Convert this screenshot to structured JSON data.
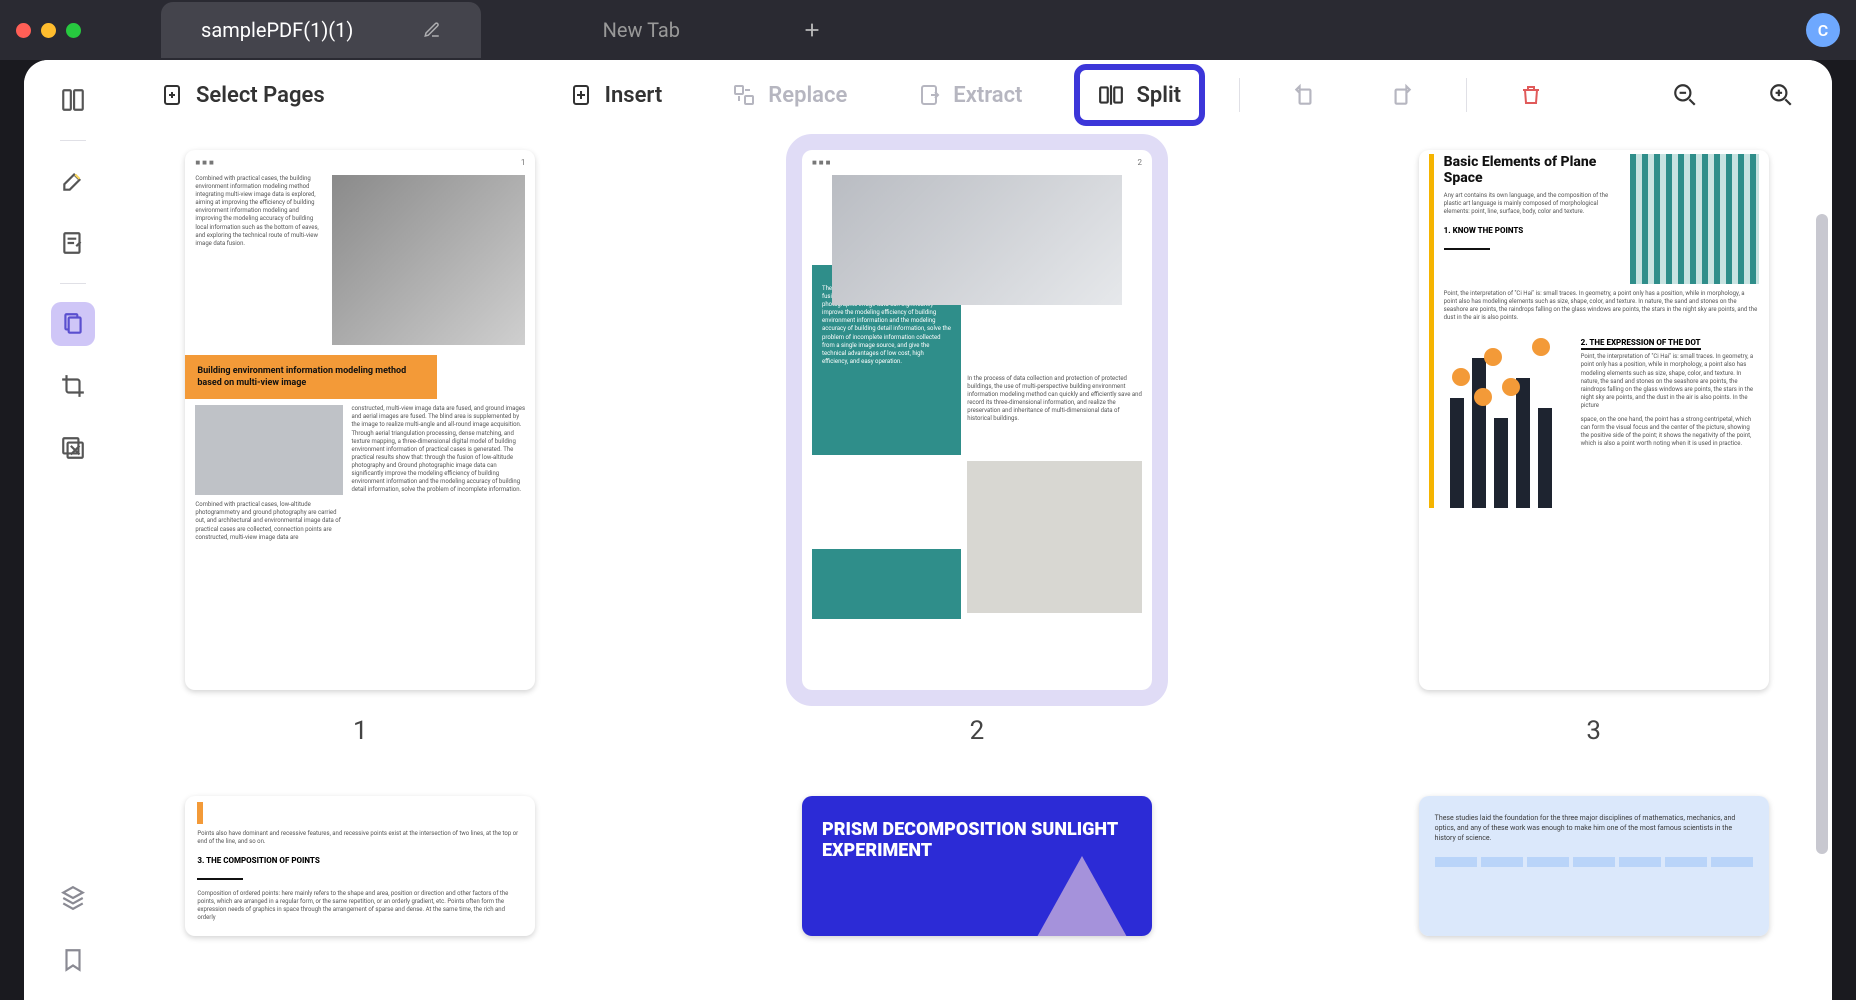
{
  "tabs": {
    "active_title": "samplePDF(1)(1)",
    "new_tab_label": "New Tab"
  },
  "avatar_initial": "C",
  "toolbar": {
    "select_pages": "Select Pages",
    "insert": "Insert",
    "replace": "Replace",
    "extract": "Extract",
    "split": "Split"
  },
  "pages": {
    "p1_num": "1",
    "p2_num": "2",
    "p3_num": "3",
    "p1_hdr_r": "1",
    "p2_hdr_r": "2",
    "p1_orange_title": "Building environment information modeling method based on multi-view image",
    "p1_top_text": "Combined with practical cases, the building environment information modeling method integrating multi-view image data is explored, aiming at improving the efficiency of building environment information modeling and improving the modeling accuracy of building local information such as the bottom of eaves, and exploring the technical route of multi-view image data fusion.",
    "p1_right_text": "constructed, multi-view image data are fused, and ground images and aerial images are fused. The blind area is supplemented by the image to realize multi-angle and all-round image acquisition. Through aerial triangulation processing, dense matching, and texture mapping, a three-dimensional digital model of building environment information of practical cases is generated. The practical results show that: through the fusion of low-altitude photography and Ground photographic image data can significantly improve the modeling efficiency of building environment information and the modeling accuracy of building detail information, solve the problem of incomplete information.",
    "p1_bl_text": "Combined with practical cases, low-altitude photogrammetry and ground photography are carried out, and architectural and environmental image data of practical cases are collected, connection points are constructed, multi-view image data are",
    "p2_teal_text": "The practical results show that: through the fusion of low-altitude photography and Ground photographic image data can significantly improve the modeling efficiency of building environment information and the modeling accuracy of building detail information, solve the problem of incomplete information collected from a single image source, and give the technical advantages of low cost, high efficiency, and easy operation.",
    "p2_right_text": "In the process of data collection and protection of protected buildings, the use of multi-perspective building environment information modeling method can quickly and efficiently save and record its three-dimensional information, and realize the preservation and inheritance of multi-dimensional data of historical buildings.",
    "p3_title": "Basic Elements of Plane Space",
    "p3_intro": "Any art contains its own language, and the composition of the plastic art language is mainly composed of morphological elements: point, line, surface, body, color and texture.",
    "p3_h1": "1. KNOW THE POINTS",
    "p3_para1": "Point, the interpretation of \"Ci Hai\" is: small traces. In geometry, a point only has a position, while in morphology, a point also has modeling elements such as size, shape, color, and texture. In nature, the sand and stones on the seashore are points, the raindrops falling on the glass windows are points, the stars in the night sky are points, and the dust in the air is also points.",
    "p3_h2": "2. THE EXPRESSION OF THE DOT",
    "p3_para2": "Point, the interpretation of \"Ci Hai\" is: small traces. In geometry, a point only has a position, while in morphology, a point also has modeling elements such as size, shape, color, and texture. In nature, the sand and stones on the seashore are points, the raindrops falling on the glass windows are points, the stars in the night sky are points, and the dust in the air is also points. In the picture",
    "p3_para3": "space, on the one hand, the point has a strong centripetal, which can form the visual focus and the center of the picture, showing the positive side of the point; it shows the negativity of the point, which is also a point worth noting when it is used in practice.",
    "p4_intro": "Points also have dominant and recessive features, and recessive points exist at the intersection of two lines, at the top or end of the line, and so on.",
    "p4_h1": "3. THE COMPOSITION OF POINTS",
    "p4_para": "Composition of ordered points: here mainly refers to the shape and area, position or direction and other factors of the points, which are arranged in a regular form, or the same repetition, or an orderly gradient, etc. Points often form the expression needs of graphics in space through the arrangement of sparse and dense. At the same time, the rich and orderly",
    "p5_title": "PRISM DECOMPOSITION SUNLIGHT EXPERIMENT",
    "p6_para": "These studies laid the foundation for the three major disciplines of mathematics, mechanics, and optics, and any of these work was enough to make him one of the most famous scientists in the history of science."
  }
}
